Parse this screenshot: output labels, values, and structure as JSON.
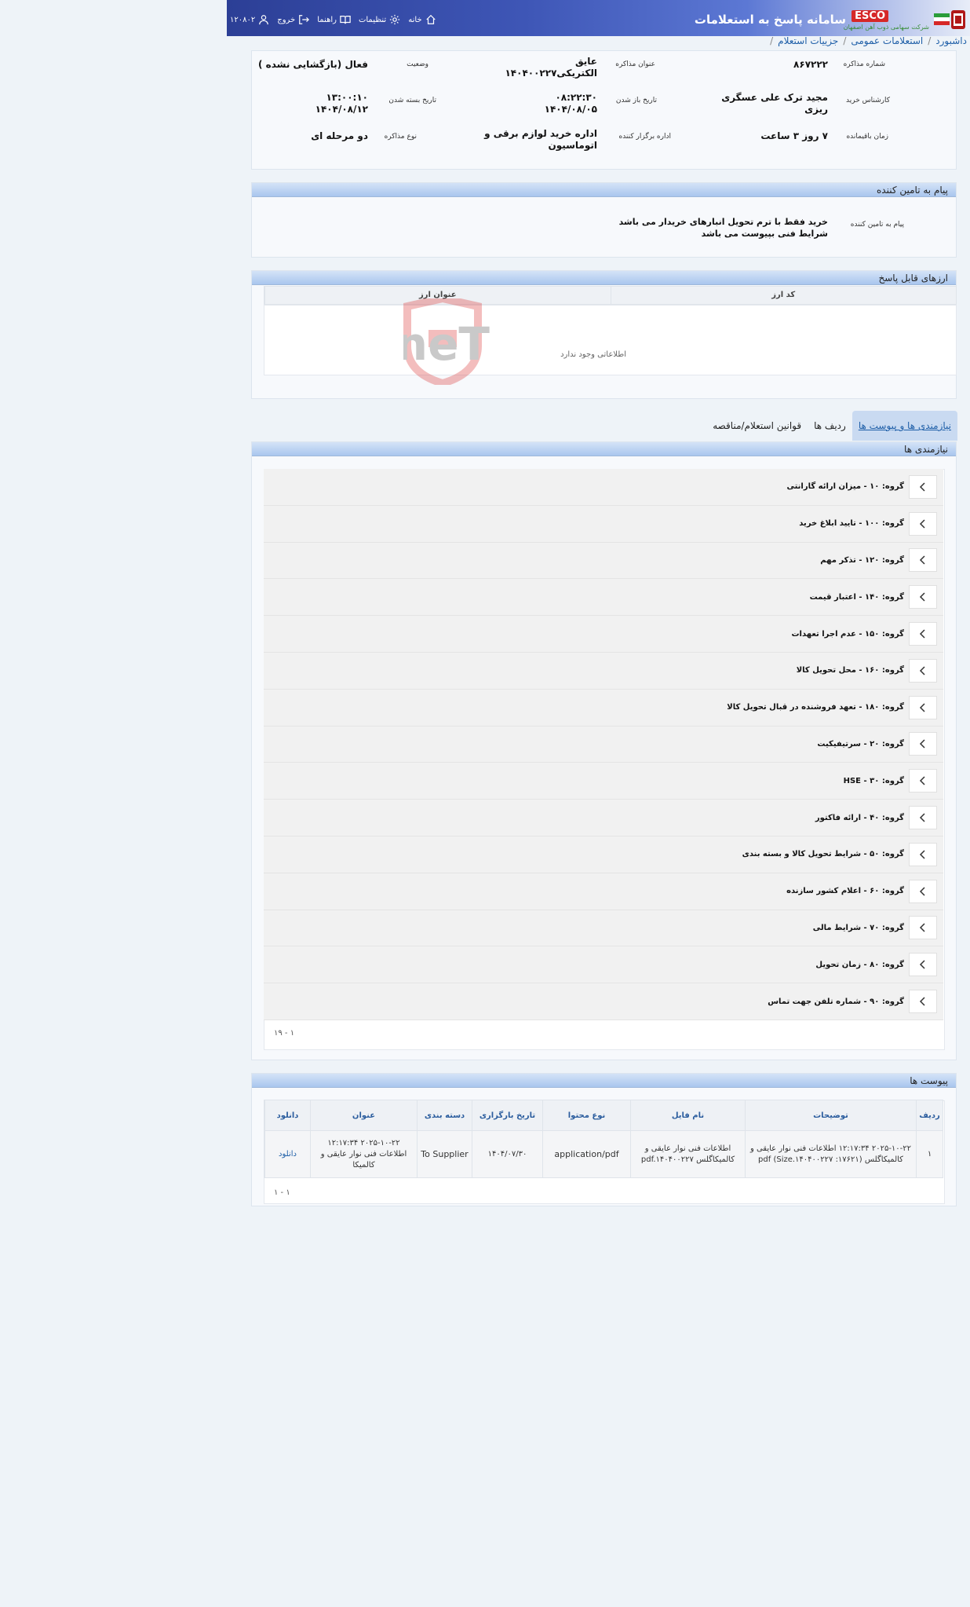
{
  "header": {
    "app_title": "سامانه پاسخ به استعلامات",
    "esco_label": "ESCO",
    "esco_subtitle": "شرکت سهامی ذوب آهن اصفهان",
    "nav": {
      "home": "خانه",
      "settings": "تنظیمات",
      "guide": "راهنما",
      "logout": "خروج",
      "user_id": "۱۲۰۸۰۲"
    }
  },
  "breadcrumb": {
    "dashboard": "داشبورد",
    "general_inquiries": "استعلامات عمومی",
    "inquiry_details": "جزییات استعلام"
  },
  "details": {
    "negotiation_number_label": "شماره مذاکره",
    "negotiation_number": "۸۶۷۲۲۲",
    "negotiation_title_label": "عنوان مذاکره",
    "negotiation_title_line1": "عایق",
    "negotiation_title_line2": "الکتریکی۱۴۰۴۰۰۲۲۷",
    "status_label": "وضعیت",
    "status": "فعال (بازگشایی نشده )",
    "buyer_expert_label": "کارشناس خرید",
    "buyer_expert_line1": "مجید ترک علی عسگری",
    "buyer_expert_line2": "ریزی",
    "open_date_label": "تاریخ باز شدن",
    "open_time": "۰۸:۲۲:۳۰",
    "open_date": "۱۴۰۴/۰۸/۰۵",
    "close_date_label": "تاریخ بسته شدن",
    "close_time": "۱۳:۰۰:۱۰",
    "close_date": "۱۴۰۴/۰۸/۱۲",
    "remaining_label": "زمان باقیمانده",
    "remaining": "۷ روز ۳ ساعت",
    "organizer_label": "اداره برگزار کننده",
    "organizer_line1": "اداره خرید لوازم برقی و",
    "organizer_line2": "اتوماسیون",
    "negotiation_type_label": "نوع مذاکره",
    "negotiation_type": "دو مرحله ای"
  },
  "supplier_message": {
    "section_title": "پیام به تامین کننده",
    "label": "پیام به تامین کننده",
    "line1": "خرید فقط با ترم تحویل انبارهای خریدار می باشد",
    "line2": "شرایط فنی بپیوست می باشد"
  },
  "currencies": {
    "section_title": "ارزهای قابل پاسخ",
    "col_code": "کد ارز",
    "col_title": "عنوان ارز",
    "empty": "اطلاعاتی وجود ندارد",
    "watermark": "AriaTender.neT"
  },
  "tabs": [
    {
      "label": "نیازمندی ها و پیوست ها"
    },
    {
      "label": "ردیف ها"
    },
    {
      "label": "قوانین استعلام/مناقصه"
    }
  ],
  "requirements": {
    "section_title": "نیازمندی ها",
    "groups": [
      "گروه: ۱۰ - میزان ارائه گارانتی",
      "گروه: ۱۰۰ - تایید ابلاغ خرید",
      "گروه: ۱۲۰ - تذکر مهم",
      "گروه: ۱۴۰ - اعتبار قیمت",
      "گروه: ۱۵۰ - عدم اجرا تعهدات",
      "گروه: ۱۶۰ - محل تحویل کالا",
      "گروه: ۱۸۰ - تعهد فروشنده در قبال تحویل کالا",
      "گروه: ۲۰ - سرتیفیکیت",
      "گروه: ۳۰ - HSE",
      "گروه: ۴۰ - ارائه فاکتور",
      "گروه: ۵۰ - شرایط تحویل کالا و بسته بندی",
      "گروه: ۶۰ - اعلام کشور سازنده",
      "گروه: ۷۰ - شرایط مالی",
      "گروه: ۸۰ - زمان تحویل",
      "گروه: ۹۰ - شماره تلفن جهت تماس"
    ],
    "pager": "۱ - ۱۹"
  },
  "attachments": {
    "section_title": "پیوست ها",
    "headers": {
      "row": "ردیف",
      "description": "توضیحات",
      "filename": "نام فایل",
      "content_type": "نوع محتوا",
      "upload_date": "تاریخ بارگزاری",
      "category": "دسته بندی",
      "title": "عنوان",
      "download": "دانلود"
    },
    "rows": [
      {
        "row": "۱",
        "description": "۲۰۲۵-۱۰-۲۲ ۱۲:۱۷:۳۴ اطلاعات فنی نوار عایقی و کالمیکاگلس pdf (Size.۱۴۰۴۰۰۲۲۷ :۱۷۶۲۱)",
        "filename": "اطلاعات فنی نوار عایقی و کالمیکاگلس pdf.۱۴۰۴۰۰۲۲۷",
        "content_type": "application/pdf",
        "upload_date": "۱۴۰۴/۰۷/۳۰",
        "category": "To Supplier",
        "title": "۲۰۲۵-۱۰-۲۲ ۱۲:۱۷:۳۴ اطلاعات فنی نوار عایقی و کالمیکا",
        "download": "دانلود"
      }
    ],
    "pager": "۱ - ۱"
  }
}
